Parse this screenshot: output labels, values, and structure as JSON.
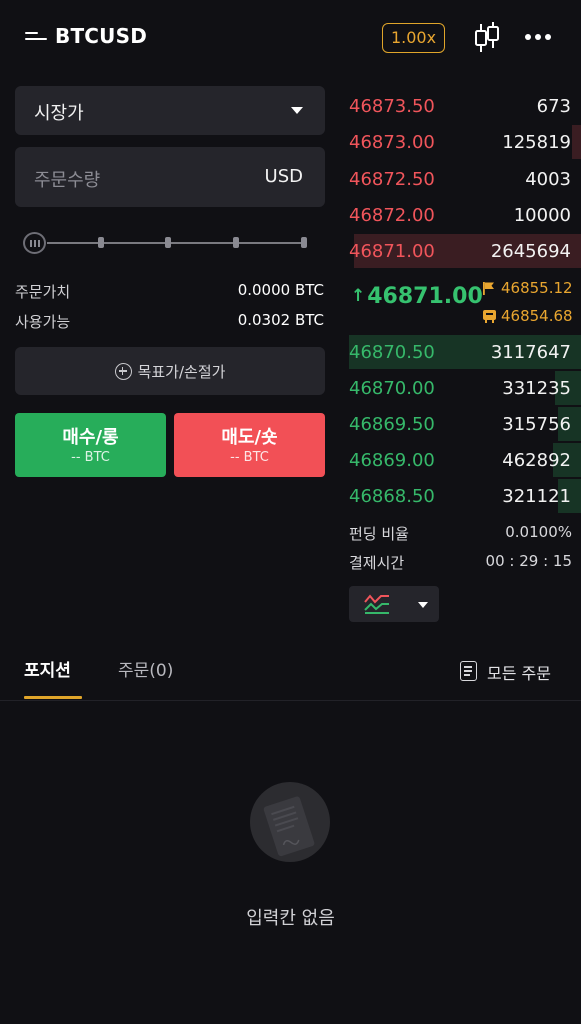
{
  "header": {
    "title": "BTCUSD",
    "leverage": "1.00x",
    "menu_icon": "menu-icon",
    "chart_icon": "candlestick-icon",
    "more_icon": "more-icon"
  },
  "order_form": {
    "order_type": "시장가",
    "quantity_placeholder": "주문수량",
    "quantity_unit": "USD",
    "slider_level_percent": 0,
    "order_value_label": "주문가치",
    "order_value": "0.0000 BTC",
    "available_label": "사용가능",
    "available_value": "0.0302 BTC",
    "tpsl_label": "목표가/손절가",
    "buy_label": "매수/롱",
    "buy_sub": "-- BTC",
    "sell_label": "매도/숏",
    "sell_sub": "-- BTC"
  },
  "order_book": {
    "asks": [
      {
        "price": "46873.50",
        "qty": "673",
        "depth_fraction": 0
      },
      {
        "price": "46873.00",
        "qty": "125819",
        "depth_fraction": 0.04
      },
      {
        "price": "46872.50",
        "qty": "4003",
        "depth_fraction": 0
      },
      {
        "price": "46872.00",
        "qty": "10000",
        "depth_fraction": 0
      },
      {
        "price": "46871.00",
        "qty": "2645694",
        "depth_fraction": 0.98
      }
    ],
    "last_price": "46871.00",
    "mark_price": "46855.12",
    "index_price": "46854.68",
    "bids": [
      {
        "price": "46870.50",
        "qty": "3117647",
        "depth_fraction": 1.0
      },
      {
        "price": "46870.00",
        "qty": "331235",
        "depth_fraction": 0.11
      },
      {
        "price": "46869.50",
        "qty": "315756",
        "depth_fraction": 0.1
      },
      {
        "price": "46869.00",
        "qty": "462892",
        "depth_fraction": 0.12
      },
      {
        "price": "46868.50",
        "qty": "321121",
        "depth_fraction": 0.1
      }
    ],
    "funding_label": "펀딩 비율",
    "funding_value": "0.0100%",
    "settlement_label": "결제시간",
    "settlement_value": "00 : 29 : 15"
  },
  "tabs": [
    {
      "label": "포지션",
      "active": true
    },
    {
      "label": "주문(0)",
      "active": false
    }
  ],
  "all_orders_label": "모든 주문",
  "empty_text": "입력칸 없음",
  "colors": {
    "ask": "#f0555b",
    "bid": "#36b86a",
    "accent": "#e0a52a",
    "buy": "#27ad5a",
    "sell": "#f25056"
  }
}
